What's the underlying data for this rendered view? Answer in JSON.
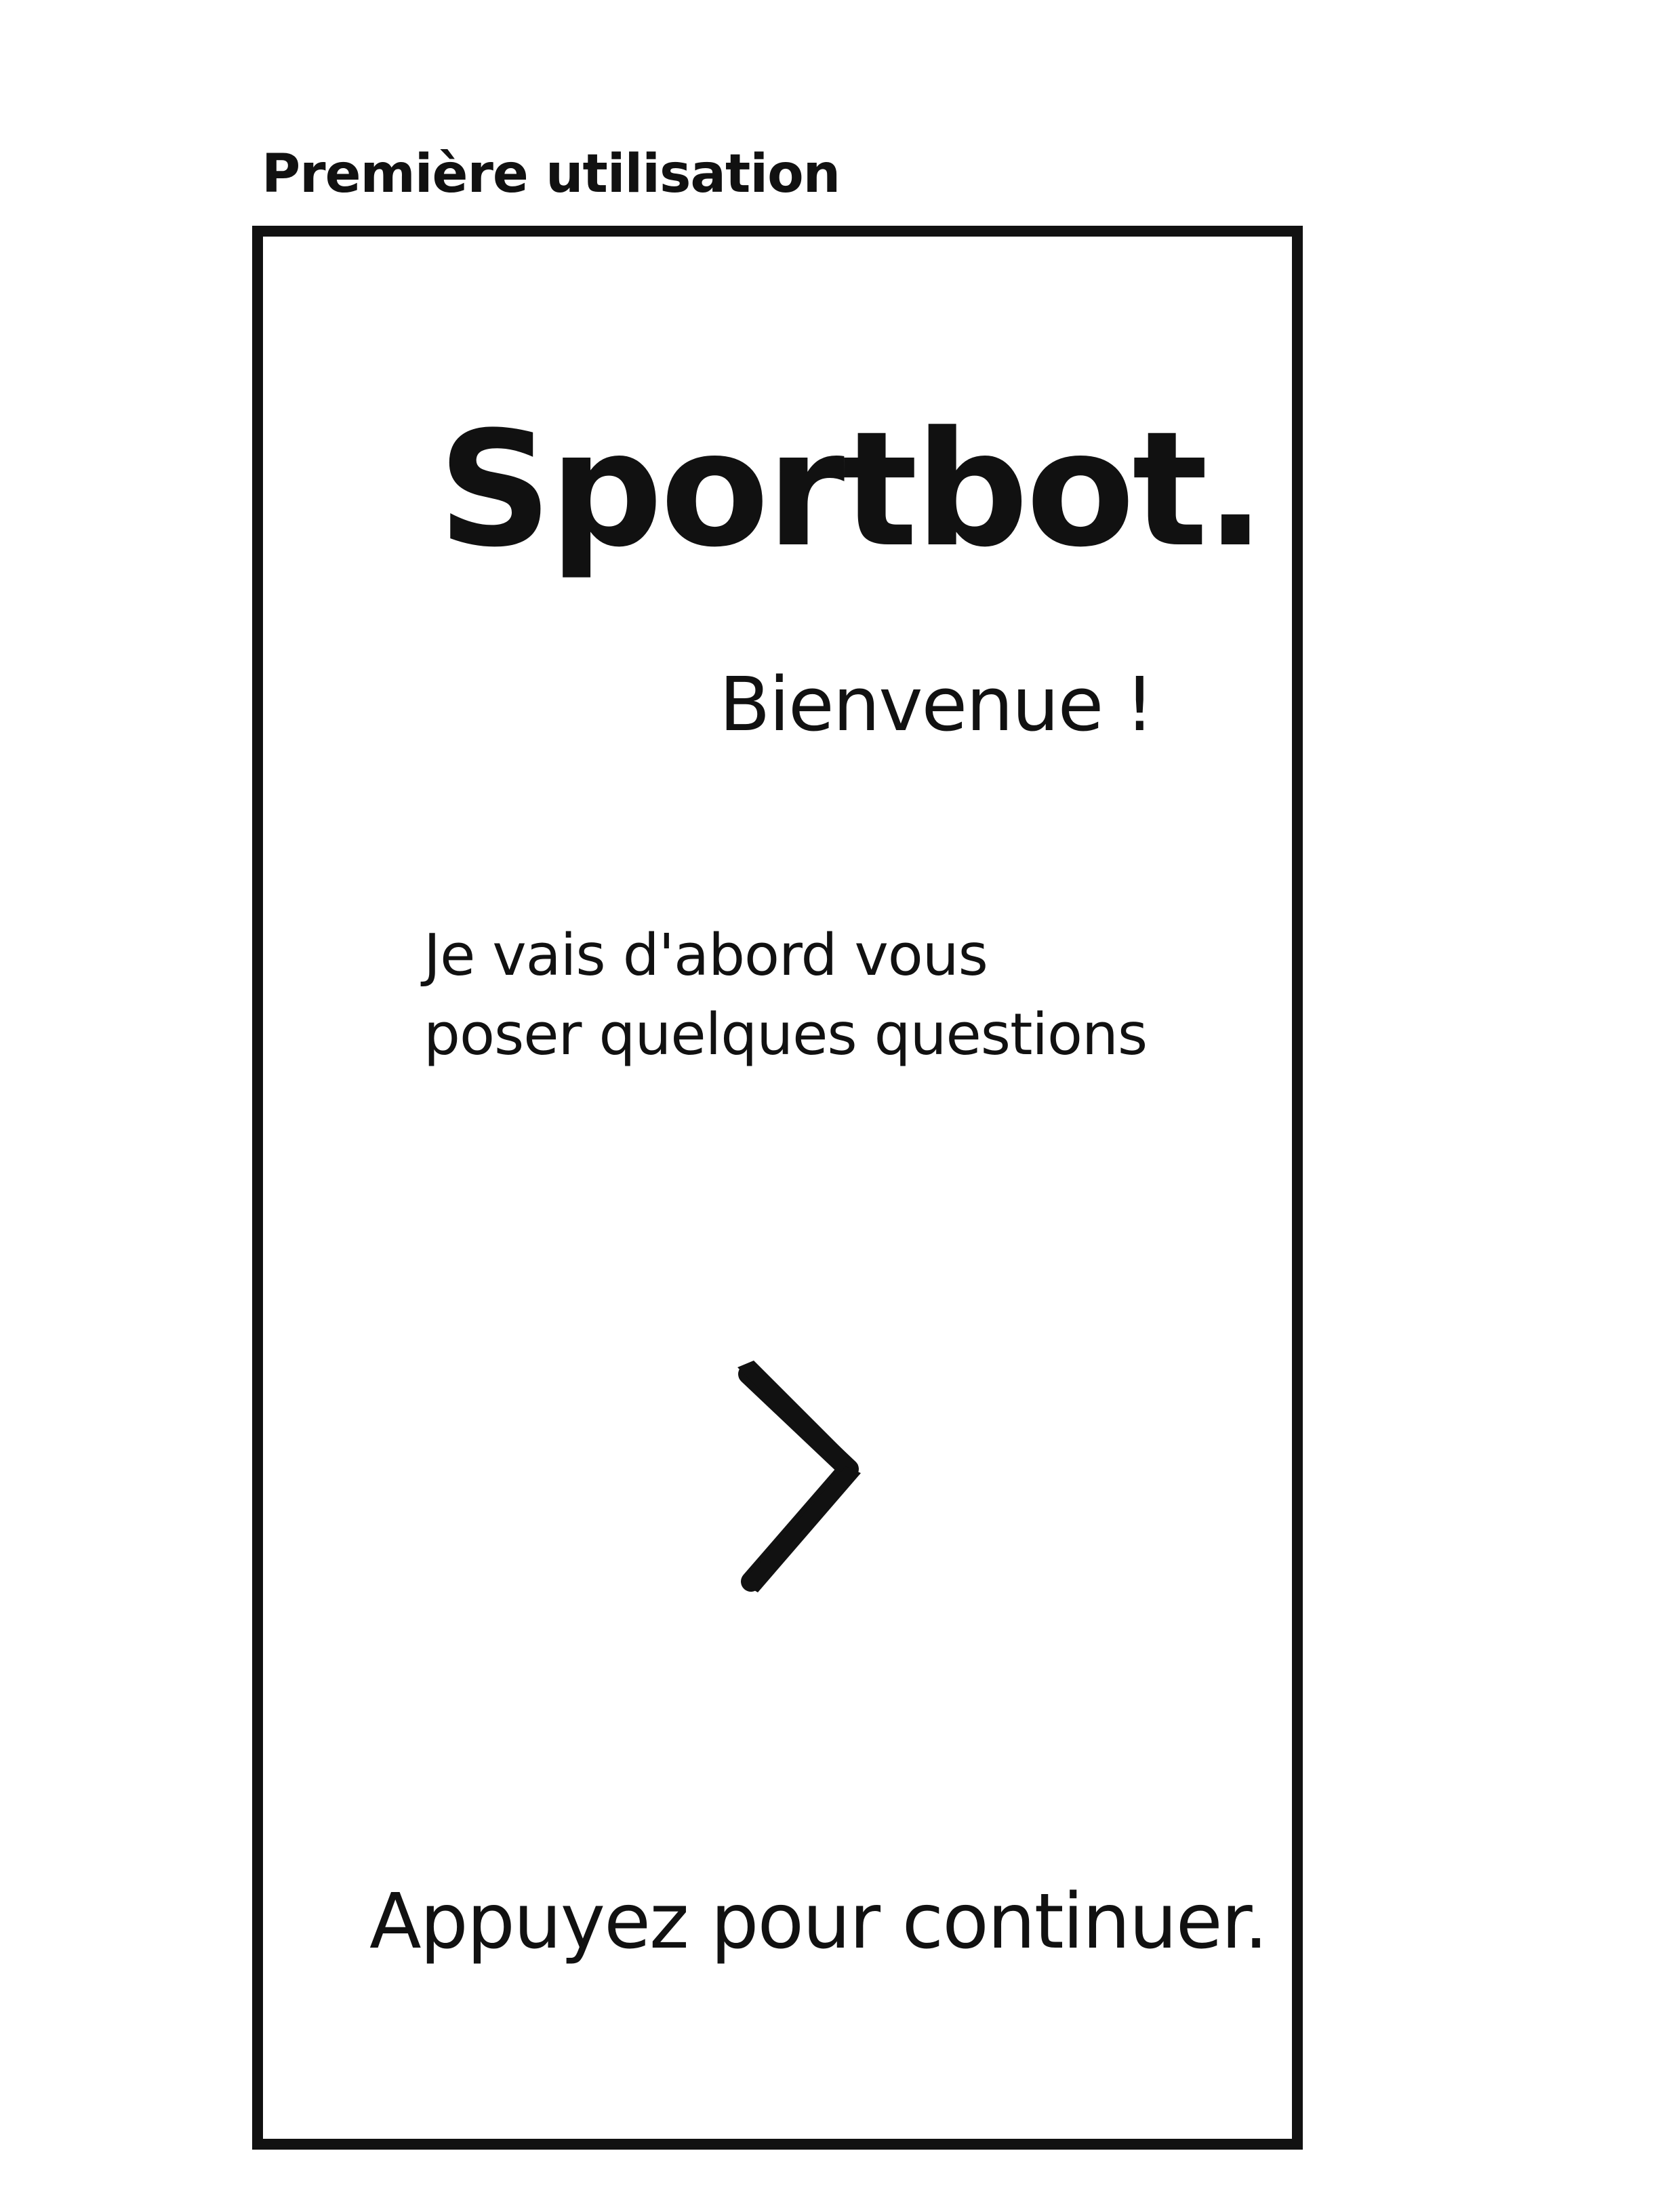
{
  "screen": {
    "caption": "Première utilisation"
  },
  "app": {
    "title": "Sportbot.",
    "welcome": "Bienvenue !",
    "intro_lines": [
      "Je vais d'abord vous",
      "poser quelques questions"
    ],
    "next_icon": "chevron-right-icon",
    "continue_label": "Appuyez pour continuer."
  }
}
